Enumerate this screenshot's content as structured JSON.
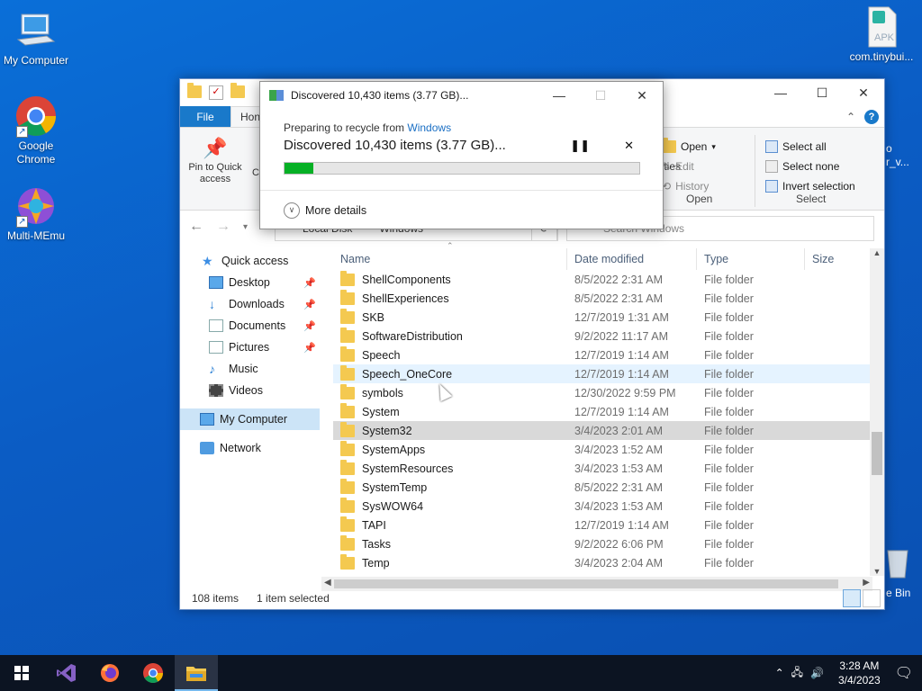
{
  "desktop": {
    "icons": [
      {
        "label": "My Computer"
      },
      {
        "label": "Google Chrome"
      },
      {
        "label": "Multi-MEmu"
      },
      {
        "label": "com.tinybui..."
      },
      {
        "label": "e Bin"
      }
    ],
    "apk_badge": "APK",
    "partial_right": [
      "o",
      "r_v..."
    ]
  },
  "explorer": {
    "tabs": {
      "file": "File",
      "home": "Hon"
    },
    "ribbon": {
      "pin_label": "Pin to Quick access",
      "co_partial": "Co",
      "properties_partial": "perties",
      "open": "Open",
      "edit": "Edit",
      "history": "History",
      "open_group": "Open",
      "select_all": "Select all",
      "select_none": "Select none",
      "invert_selection": "Invert selection",
      "select_group": "Select"
    },
    "address": {
      "crumb1": "Local Disk",
      "crumb2": "Windows"
    },
    "search_placeholder": "Search Windows",
    "sidebar": {
      "quick_access": "Quick access",
      "desktop": "Desktop",
      "downloads": "Downloads",
      "documents": "Documents",
      "pictures": "Pictures",
      "music": "Music",
      "videos": "Videos",
      "my_computer": "My Computer",
      "network": "Network"
    },
    "columns": {
      "name": "Name",
      "date": "Date modified",
      "type": "Type",
      "size": "Size"
    },
    "rows": [
      {
        "name": "ShellComponents",
        "date": "8/5/2022 2:31 AM",
        "type": "File folder"
      },
      {
        "name": "ShellExperiences",
        "date": "8/5/2022 2:31 AM",
        "type": "File folder"
      },
      {
        "name": "SKB",
        "date": "12/7/2019 1:31 AM",
        "type": "File folder"
      },
      {
        "name": "SoftwareDistribution",
        "date": "9/2/2022 11:17 AM",
        "type": "File folder"
      },
      {
        "name": "Speech",
        "date": "12/7/2019 1:14 AM",
        "type": "File folder"
      },
      {
        "name": "Speech_OneCore",
        "date": "12/7/2019 1:14 AM",
        "type": "File folder"
      },
      {
        "name": "symbols",
        "date": "12/30/2022 9:59 PM",
        "type": "File folder"
      },
      {
        "name": "System",
        "date": "12/7/2019 1:14 AM",
        "type": "File folder"
      },
      {
        "name": "System32",
        "date": "3/4/2023 2:01 AM",
        "type": "File folder"
      },
      {
        "name": "SystemApps",
        "date": "3/4/2023 1:52 AM",
        "type": "File folder"
      },
      {
        "name": "SystemResources",
        "date": "3/4/2023 1:53 AM",
        "type": "File folder"
      },
      {
        "name": "SystemTemp",
        "date": "8/5/2022 2:31 AM",
        "type": "File folder"
      },
      {
        "name": "SysWOW64",
        "date": "3/4/2023 1:53 AM",
        "type": "File folder"
      },
      {
        "name": "TAPI",
        "date": "12/7/2019 1:14 AM",
        "type": "File folder"
      },
      {
        "name": "Tasks",
        "date": "9/2/2022 6:06 PM",
        "type": "File folder"
      },
      {
        "name": "Temp",
        "date": "3/4/2023 2:04 AM",
        "type": "File folder"
      }
    ],
    "status": {
      "count": "108 items",
      "selection": "1 item selected"
    }
  },
  "dialog": {
    "title": "Discovered 10,430 items (3.77 GB)...",
    "sub_prefix": "Preparing to recycle from ",
    "sub_link": "Windows",
    "main": "Discovered 10,430 items (3.77 GB)...",
    "progress_percent": 8,
    "more_details": "More details"
  },
  "taskbar": {
    "time": "3:28 AM",
    "date": "3/4/2023"
  },
  "colors": {
    "accent": "#1979ca",
    "progress": "#06b025",
    "desktop": "#0b5cc4"
  }
}
